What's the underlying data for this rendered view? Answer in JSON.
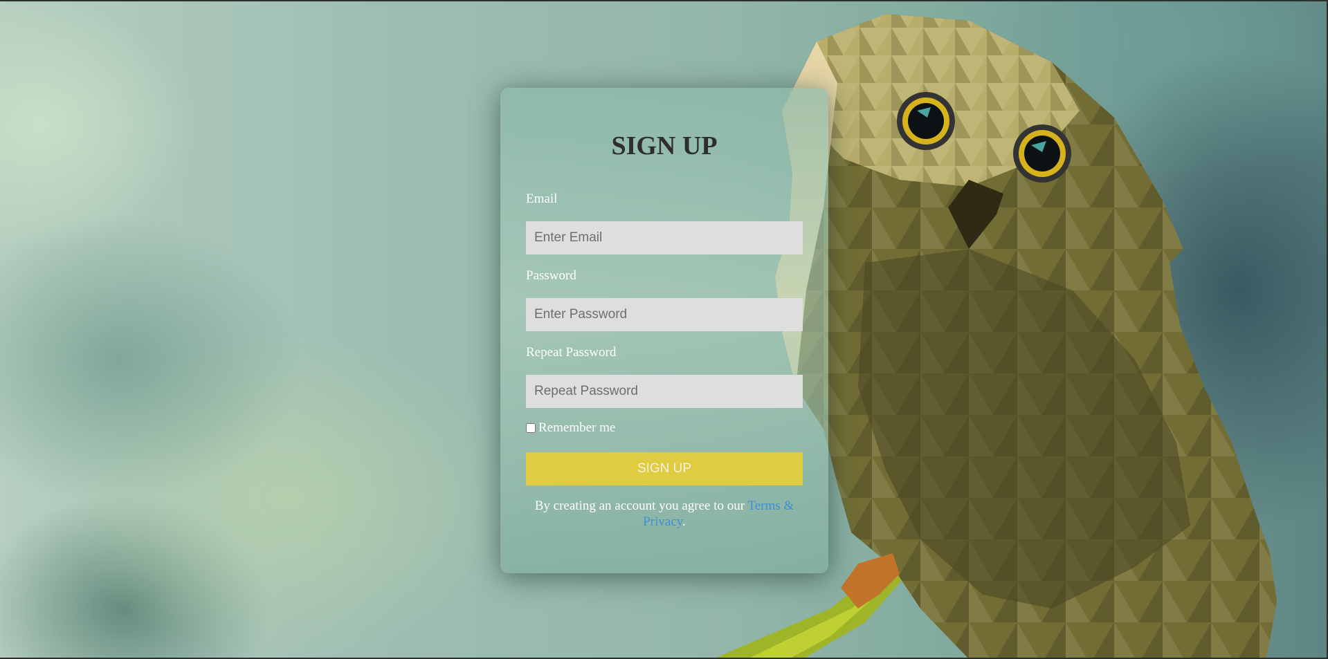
{
  "form": {
    "title": "SIGN UP",
    "email_label": "Email",
    "email_placeholder": "Enter Email",
    "password_label": "Password",
    "password_placeholder": "Enter Password",
    "repeat_label": "Repeat Password",
    "repeat_placeholder": "Repeat Password",
    "remember_label": "Remember me",
    "remember_checked": false,
    "submit_label": "SIGN UP",
    "terms_prefix": "By creating an account you agree to our ",
    "terms_link": "Terms & Privacy",
    "terms_suffix": "."
  },
  "colors": {
    "button": "#dfcc40",
    "link": "#3d8fd6",
    "input_bg": "#dedede"
  },
  "background": {
    "image": "low-poly-owl-icon"
  }
}
